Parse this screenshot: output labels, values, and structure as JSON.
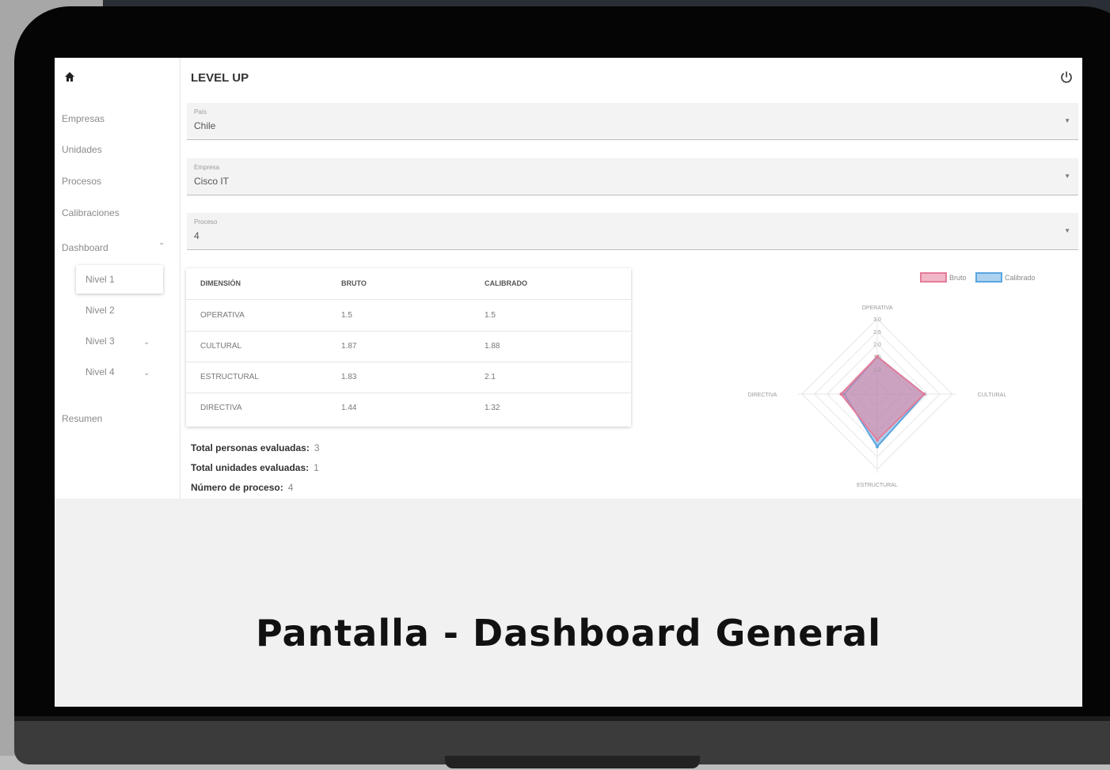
{
  "app": {
    "title": "LEVEL UP",
    "accent_color": "#e57c9a",
    "secondary_color": "#5aa6e0"
  },
  "sidebar": {
    "items": [
      {
        "label": "Empresas"
      },
      {
        "label": "Unidades"
      },
      {
        "label": "Procesos"
      },
      {
        "label": "Calibraciones"
      },
      {
        "label": "Dashboard"
      },
      {
        "label": "Resumen"
      }
    ],
    "dashboard_sub": [
      {
        "label": "Nivel 1",
        "active": true
      },
      {
        "label": "Nivel 2"
      },
      {
        "label": "Nivel 3"
      },
      {
        "label": "Nivel 4"
      }
    ]
  },
  "filters": [
    {
      "label": "País",
      "value": "Chile"
    },
    {
      "label": "Empresa",
      "value": "Cisco IT"
    },
    {
      "label": "Proceso",
      "value": "4"
    }
  ],
  "table": {
    "headers": [
      "DIMENSIÓN",
      "BRUTO",
      "CALIBRADO"
    ],
    "rows": [
      [
        "OPERATIVA",
        "1.5",
        "1.5"
      ],
      [
        "CULTURAL",
        "1.87",
        "1.88"
      ],
      [
        "ESTRUCTURAL",
        "1.83",
        "2.1"
      ],
      [
        "DIRECTIVA",
        "1.44",
        "1.32"
      ]
    ]
  },
  "totals": [
    {
      "label": "Total personas evaluadas:",
      "value": "3"
    },
    {
      "label": "Total unidades evaluadas:",
      "value": "1"
    },
    {
      "label": "Número de proceso:",
      "value": "4"
    }
  ],
  "chart_data": {
    "type": "radar",
    "categories": [
      "OPERATIVA",
      "CULTURAL",
      "ESTRUCTURAL",
      "DIRECTIVA"
    ],
    "ticks": [
      "1.0",
      "1.5",
      "2.0",
      "2.5",
      "3.0"
    ],
    "series": [
      {
        "name": "Bruto",
        "values": [
          1.5,
          1.87,
          1.83,
          1.44
        ],
        "color": "#e57c9a"
      },
      {
        "name": "Calibrado",
        "values": [
          1.5,
          1.88,
          2.1,
          1.32
        ],
        "color": "#5aa6e0"
      }
    ],
    "rlim": [
      0,
      3
    ],
    "legend": "top"
  },
  "caption": "Pantalla - Dashboard General"
}
